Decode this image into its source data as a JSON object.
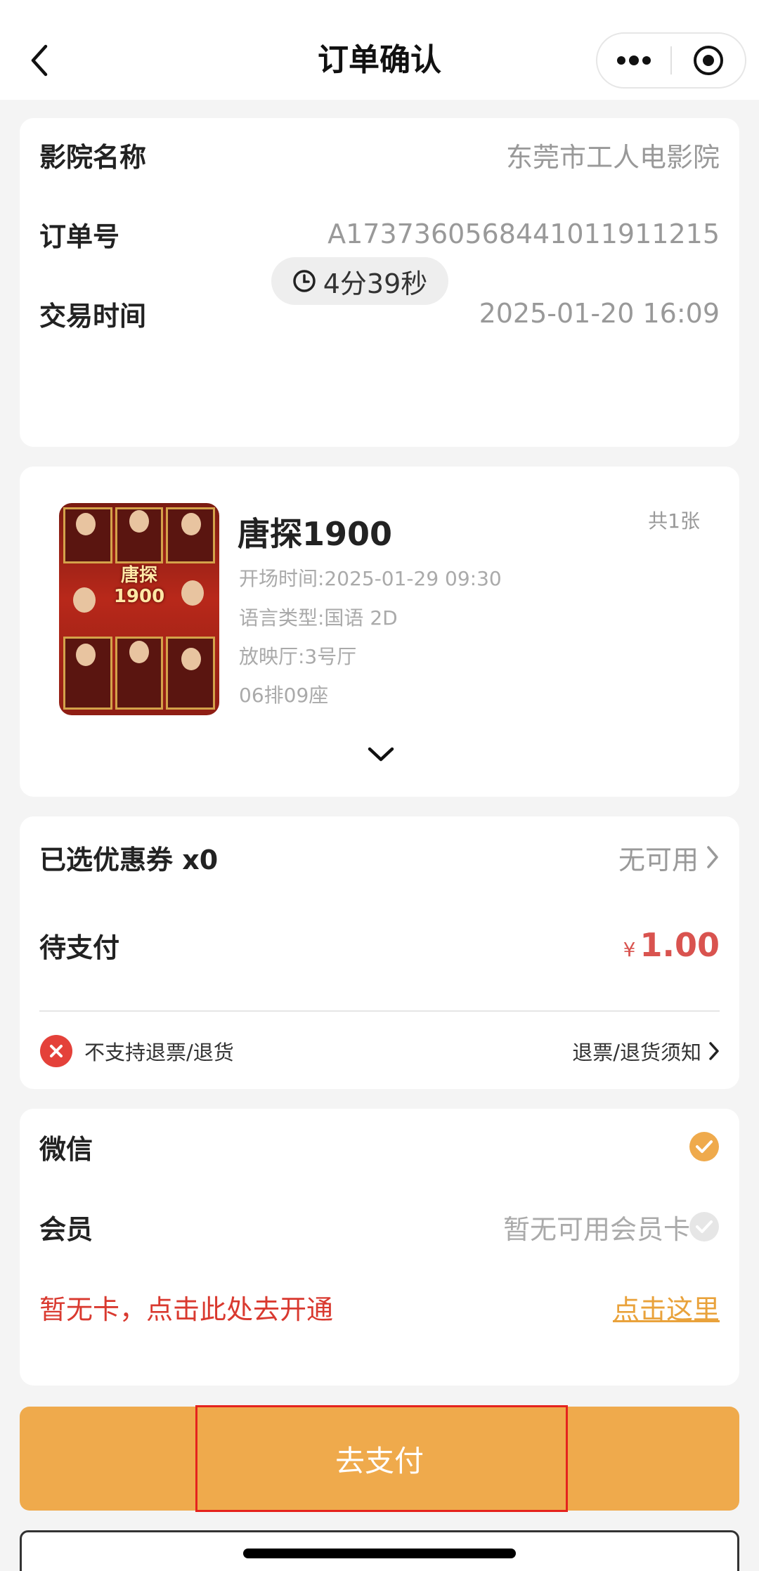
{
  "nav": {
    "title": "订单确认"
  },
  "order": {
    "cinema_label": "影院名称",
    "cinema_value": "东莞市工人电影院",
    "order_no_label": "订单号",
    "order_no_value": "A17373605684410119112​15",
    "time_label": "交易时间",
    "time_value": "2025-01-20 16:09",
    "countdown": "4分39秒"
  },
  "movie": {
    "title": "唐探1900",
    "count": "共1张",
    "showtime": "开场时间:2025-01-29 09:30",
    "language": "语言类型:国语 2D",
    "hall": "放映厅:3号厅",
    "seat": "06排09座",
    "poster_title": "唐探1900"
  },
  "payment_summary": {
    "coupon_label": "已选优惠券 x0",
    "coupon_value": "无可用",
    "pending_label": "待支付",
    "currency": "¥",
    "amount": "1.00",
    "refund_notice": "不支持退票/退货",
    "refund_link": "退票/退货须知"
  },
  "methods": {
    "wechat_label": "微信",
    "member_label": "会员",
    "member_value": "暂无可用会员卡",
    "no_card_text": "暂无卡，点击此处去开通",
    "click_here": "点击这里"
  },
  "actions": {
    "pay_label": "去支付"
  },
  "colors": {
    "accent": "#efaa4c",
    "price": "#d9534f",
    "warning_text": "#d9392f",
    "link": "#e9a23b",
    "highlight": "#e5231d"
  }
}
